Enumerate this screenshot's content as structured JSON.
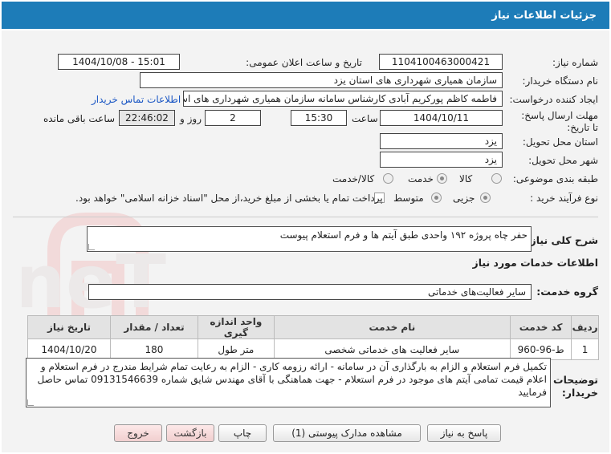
{
  "header": {
    "title": "جزئیات اطلاعات نیاز"
  },
  "form": {
    "need_number_label": "شماره نیاز:",
    "need_number": "1104100463000421",
    "announce_label": "تاریخ و ساعت اعلان عمومی:",
    "announce_value": "1404/10/08 - 15:01",
    "buyer_label": "نام دستگاه خریدار:",
    "buyer_value": "سازمان همیاری شهرداری های استان یزد",
    "creator_label": "ایجاد کننده درخواست:",
    "creator_value": "فاطمه کاظم پورکریم آبادی کارشناس سامانه سازمان همیاری شهرداری های اس",
    "contact_link": "اطلاعات تماس خریدار",
    "deadline_label": "مهلت ارسال پاسخ: تا تاریخ:",
    "deadline_date": "1404/10/11",
    "time_label": "ساعت",
    "deadline_time": "15:30",
    "days_value": "2",
    "days_label": "روز و",
    "remaining_value": "22:46:02",
    "remaining_label": "ساعت باقی مانده",
    "province_label": "استان محل تحویل:",
    "province_value": "یزد",
    "city_label": "شهر محل تحویل:",
    "city_value": "یزد",
    "category_label": "طبقه بندی موضوعی:",
    "category_options": [
      "کالا",
      "خدمت",
      "کالا/خدمت"
    ],
    "category_selected": "خدمت",
    "process_label": "نوع فرآیند خرید :",
    "process_options": [
      "جزیی",
      "متوسط"
    ],
    "process_selected": "جزیی",
    "payment_note": "پرداخت تمام یا بخشی از مبلغ خرید،از محل \"اسناد خزانه اسلامی\" خواهد بود."
  },
  "description": {
    "label": "شرح کلی نیاز:",
    "value": "حفر چاه پروژه ۱۹۲ واحدی طبق آیتم ها و فرم استعلام پیوست"
  },
  "services": {
    "section_title": "اطلاعات خدمات مورد نیاز",
    "group_label": "گروه خدمت:",
    "group_value": "سایر فعالیت‌های خدماتی",
    "columns": [
      "ردیف",
      "کد خدمت",
      "نام خدمت",
      "واحد اندازه گیری",
      "تعداد / مقدار",
      "تاریخ نیاز"
    ],
    "rows": [
      {
        "row": "1",
        "code": "ط-96-960",
        "name": "سایر فعالیت های خدماتی شخصی",
        "unit": "متر طول",
        "qty": "180",
        "date": "1404/10/20"
      }
    ]
  },
  "buyer_notes": {
    "label_1": "توضیحات",
    "label_2": "خریدار:",
    "value": "تکمیل فرم استعلام و الزام به بارگذاری آن در سامانه - ارائه رزومه کاری - الزام به رعایت تمام شرایط مندرج در فرم استعلام و اعلام قیمت تمامی آیتم های موجود در فرم استعلام - جهت هماهنگی با آقای مهندس شایق شماره 09131546639 تماس حاصل فرمایید"
  },
  "buttons": {
    "reply": "پاسخ به نیاز",
    "attachments": "مشاهده مدارک پیوستی (1)",
    "print": "چاپ",
    "back": "بازگشت",
    "exit": "خروج"
  },
  "watermark": {
    "text": "AriaTender.neT"
  }
}
